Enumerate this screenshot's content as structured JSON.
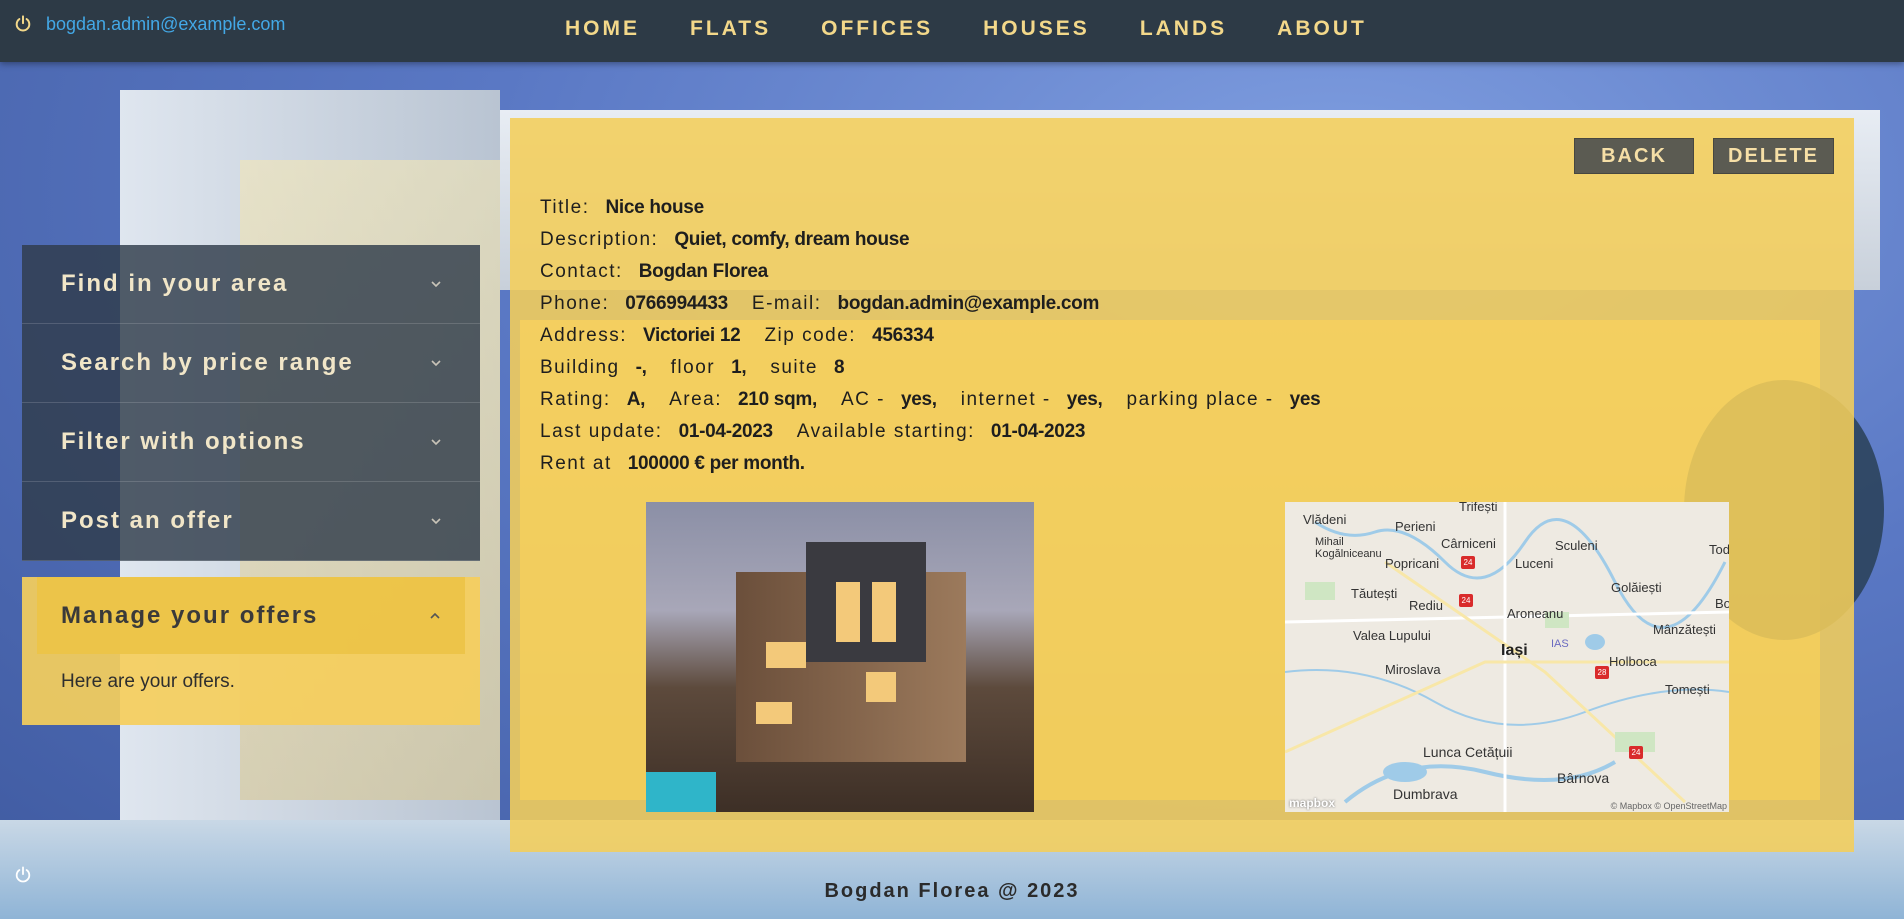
{
  "header": {
    "user_email": "bogdan.admin@example.com",
    "nav": [
      "HOME",
      "FLATS",
      "OFFICES",
      "HOUSES",
      "LANDS",
      "ABOUT"
    ]
  },
  "sidebar": {
    "items": [
      {
        "label": "Find in your area"
      },
      {
        "label": "Search by price range"
      },
      {
        "label": "Filter with options"
      },
      {
        "label": "Post an offer"
      }
    ],
    "open": {
      "label": "Manage your offers",
      "body": "Here are your offers."
    }
  },
  "offer": {
    "back_label": "BACK",
    "delete_label": "DELETE",
    "title_label": "Title:",
    "title": "Nice house",
    "description_label": "Description:",
    "description": "Quiet, comfy, dream house",
    "contact_label": "Contact:",
    "contact": "Bogdan Florea",
    "phone_label": "Phone:",
    "phone": "0766994433",
    "email_label": "E-mail:",
    "email": "bogdan.admin@example.com",
    "address_label": "Address:",
    "address": "Victoriei 12",
    "zip_label": "Zip code:",
    "zip": "456334",
    "building_label": "Building",
    "building": "-,",
    "floor_label": "floor",
    "floor": "1,",
    "suite_label": "suite",
    "suite": "8",
    "rating_label": "Rating:",
    "rating": "A,",
    "area_label": "Area:",
    "area": "210 sqm,",
    "ac_label": "AC -",
    "ac": "yes,",
    "internet_label": "internet -",
    "internet": "yes,",
    "parking_label": "parking place -",
    "parking": "yes",
    "updated_label": "Last update:",
    "updated": "01-04-2023",
    "available_label": "Available starting:",
    "available": "01-04-2023",
    "rent_label": "Rent at",
    "rent": "100000 € per month."
  },
  "map": {
    "city": "Iași",
    "airport": "IAS",
    "towns": [
      "Vlădeni",
      "Perieni",
      "Trifești",
      "Mihail Kogălniceanu",
      "Cârniceni",
      "Sculeni",
      "Popricani",
      "Luceni",
      "Todir",
      "Tăutești",
      "Rediu",
      "Golăiești",
      "Aroneanu",
      "Bo",
      "Valea Lupului",
      "Mânzătești",
      "Miroslava",
      "Holboca",
      "Tomești",
      "Lunca Cetățuii",
      "Bârnova",
      "Dumbrava"
    ],
    "road_labels": [
      "24",
      "28",
      "24",
      "24"
    ],
    "attribution": "© Mapbox © OpenStreetMap",
    "logo": "mapbox"
  },
  "footer": {
    "text": "Bogdan Florea @ 2023"
  }
}
